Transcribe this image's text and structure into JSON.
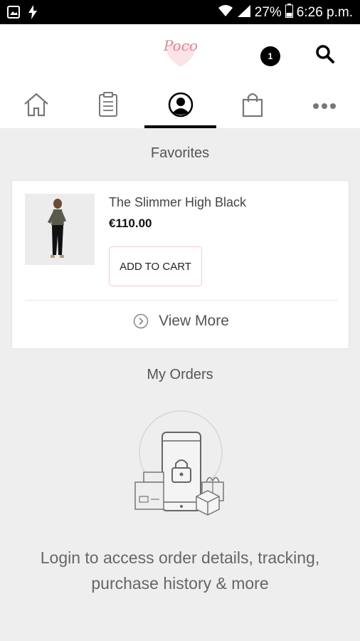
{
  "status_bar": {
    "battery": "27%",
    "time": "6:26 p.m.",
    "icons": [
      "image-icon",
      "flash-icon",
      "wifi-icon",
      "signal-icon",
      "battery-icon"
    ]
  },
  "header": {
    "logo_text": "Poco",
    "search_icon": "search-icon"
  },
  "tabs": [
    {
      "name": "home",
      "icon": "home-icon"
    },
    {
      "name": "orders",
      "icon": "clipboard-icon"
    },
    {
      "name": "account",
      "icon": "user-icon",
      "active": true
    },
    {
      "name": "cart",
      "icon": "shopping-bag-icon",
      "badge": "1"
    },
    {
      "name": "more",
      "icon": "more-icon"
    }
  ],
  "favorites": {
    "title": "Favorites",
    "product": {
      "name": "The Slimmer High Black",
      "price": "€110.00",
      "button": "ADD TO CART"
    },
    "view_more": "View More"
  },
  "orders": {
    "title": "My Orders",
    "login_line1": "Login to access order details, tracking,",
    "login_line2": "purchase history & more"
  },
  "colors": {
    "accent_pink": "#f5c9d2",
    "logo_pink": "#d98a9a",
    "background": "#eeeeee"
  }
}
